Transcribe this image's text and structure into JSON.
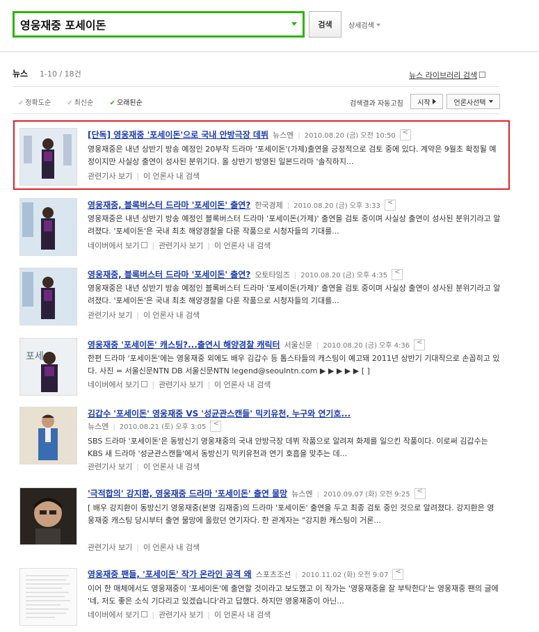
{
  "search": {
    "query": "영웅재중 포세이돈",
    "button_label": "검색",
    "advanced_label": "상세검색"
  },
  "header": {
    "section_title": "뉴스",
    "count": "1-10 / 18건",
    "library_link": "뉴스 라이브러리 검색"
  },
  "sort": {
    "options": [
      "정확도순",
      "최신순",
      "오래된순"
    ],
    "active": "오래된순",
    "auto_refresh_label": "검색결과 자동고침",
    "start_label": "시작",
    "press_select_label": "언론사선택"
  },
  "colors": {
    "accent_green": "#2db400",
    "link_blue": "#1a3ab3",
    "highlight_red": "#e0202a"
  },
  "results": [
    {
      "title": "[단독] 영웅재중 '포세이돈'으로 국내 안방극장 데뷔",
      "source": "뉴스엔",
      "date": "2010.08.20 (금) 오전 10:50",
      "desc": "영웅재중은 내년 상반기 방송 예정인 20부작 드라마 '포세이돈'(가제)출연을 긍정적으로 검토 중에 있다. 계약은 9월초 확정될 예정이지만 사실상 출연이 성사된 분위기다. 올 상반기 방영된 일본드라마 '솔직하지...",
      "links": [
        "관련기사 보기",
        "이 언론사 내 검색"
      ]
    },
    {
      "title": "영웅재중, 블록버스터 드라마 '포세이돈' 출연?",
      "source": "한국경제",
      "date": "2010.08.20 (금) 오후 3:33",
      "desc": "영웅재중은 내년 상반기 방송 예정인 블록버스터 드라마 '포세이돈(가제)' 출연을 검토 중이며 사실상 출연이 성사된 분위기라고 알려졌다. '포세이돈'은 국내 최초 해양경찰을 다룬 작품으로 시청자들의 기대를...",
      "links": [
        "네이버에서 보기",
        "관련기사 보기",
        "이 언론사 내 검색"
      ]
    },
    {
      "title": "영웅재중, 블록버스터 드라마 '포세이돈' 출연?",
      "source": "오토타임즈",
      "date": "2010.08.20 (금) 오후 4:35",
      "desc": "영웅재중은 내년 상반기 방송 예정인 블록버스터 드라마 '포세이돈(가제)' 출연을 검토 중이며 사실상 출연이 성사된 분위기라고 알려졌다. '포세이돈'은 국내 최초 해양경찰을 다룬 작품으로 시청자들의 기대를...",
      "links": [
        "관련기사 보기",
        "이 언론사 내 검색"
      ]
    },
    {
      "title": "영웅재중 '포세이돈' 캐스팅?...출연시 해양경찰 캐릭터",
      "source": "서울신문",
      "date": "2010.08.20 (금) 오후 4:36",
      "desc": "한편 드라마 '포세이돈'에는 영웅재중 외에도 배우 김갑수 등 톱스타들의 캐스팅이 예고돼 2011년 상반기 기대작으로 손꼽히고 있다. 사진 = 서울신문NTN DB 서울신문NTN legend@seoulntn.com ▶ ▶ ▶ ▶ ▶ [ ]",
      "links": [
        "네이버에서 보기",
        "관련기사 보기",
        "이 언론사 내 검색"
      ]
    },
    {
      "title": "김갑수 '포세이돈' 영웅재중 VS '성균관스캔들' 믹키유천, 누구와 연기호...",
      "source": "뉴스엔",
      "date": "2010.08.21 (토) 오후 3:05",
      "desc": "SBS 드라마 '포세이돈'은 동방신기 영웅재중의 국내 안방극장 데뷔 작품으로 알려져 화제를 일으킨 작품이다. 이로써 김갑수는 KBS 새 드라마 '성균관스캔들'에서 동방신기 믹키유천과 연기 호흡을 맞추는 데...",
      "links": [
        "관련기사 보기",
        "이 언론사 내 검색"
      ]
    },
    {
      "title": "'극적합의' 강지환, 영웅재중 드라마 '포세이돈' 출연 물망",
      "source": "뉴스엔",
      "date": "2010.09.07 (화) 오전 9:25",
      "desc": "[ 배우 강지환이 동방신기 영웅재중(본명 김재중)의 드라마 '포세이돈' 출연을 두고 최종 검토 중인 것으로 알려졌다. 강지환은 영웅재중 캐스팅 당시부터 출연 물망에 올랐던 연기자다. 한 관계자는 \"강지환 캐스팅이 거론...",
      "links": [
        "관련기사 보기",
        "이 언론사 내 검색"
      ]
    },
    {
      "title": "영웅재중 팬들, '포세이돈' 작가 온라인 공격 왜",
      "source": "스포츠조선",
      "date": "2010.11.02 (화) 오전 9:07",
      "desc": "이어 한 매체에서도 영웅재중이 '포세이돈'에 출연할 것이라고 보도했고 이 작가는 '영웅재중을 잘 부탁한다'는 영웅재중 팬의 글에 '네, 저도 좋은 소식 기다리고 있겠습니다'라고 답했다. 하지만 영웅재중이 아닌...",
      "links": [
        "네이버에서 보기",
        "관련기사 보기",
        "이 언론사 내 검색"
      ]
    }
  ]
}
